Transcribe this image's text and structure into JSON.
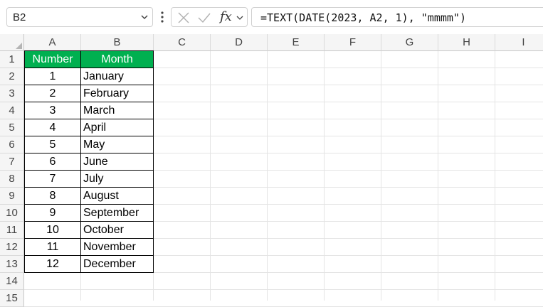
{
  "formula_bar": {
    "name_box": "B2",
    "fx_label": "fx",
    "formula": "=TEXT(DATE(2023, A2, 1), \"mmmm\")"
  },
  "columns": [
    "A",
    "B",
    "C",
    "D",
    "E",
    "F",
    "G",
    "H",
    "I"
  ],
  "rows": [
    "1",
    "2",
    "3",
    "4",
    "5",
    "6",
    "7",
    "8",
    "9",
    "10",
    "11",
    "12",
    "13",
    "14",
    "15"
  ],
  "table": {
    "headers": [
      "Number",
      "Month"
    ],
    "rows": [
      [
        "1",
        "January"
      ],
      [
        "2",
        "February"
      ],
      [
        "3",
        "March"
      ],
      [
        "4",
        "April"
      ],
      [
        "5",
        "May"
      ],
      [
        "6",
        "June"
      ],
      [
        "7",
        "July"
      ],
      [
        "8",
        "August"
      ],
      [
        "9",
        "September"
      ],
      [
        "10",
        "October"
      ],
      [
        "11",
        "November"
      ],
      [
        "12",
        "December"
      ]
    ]
  },
  "colors": {
    "header_fill": "#00b050",
    "header_text": "#ffffff"
  }
}
